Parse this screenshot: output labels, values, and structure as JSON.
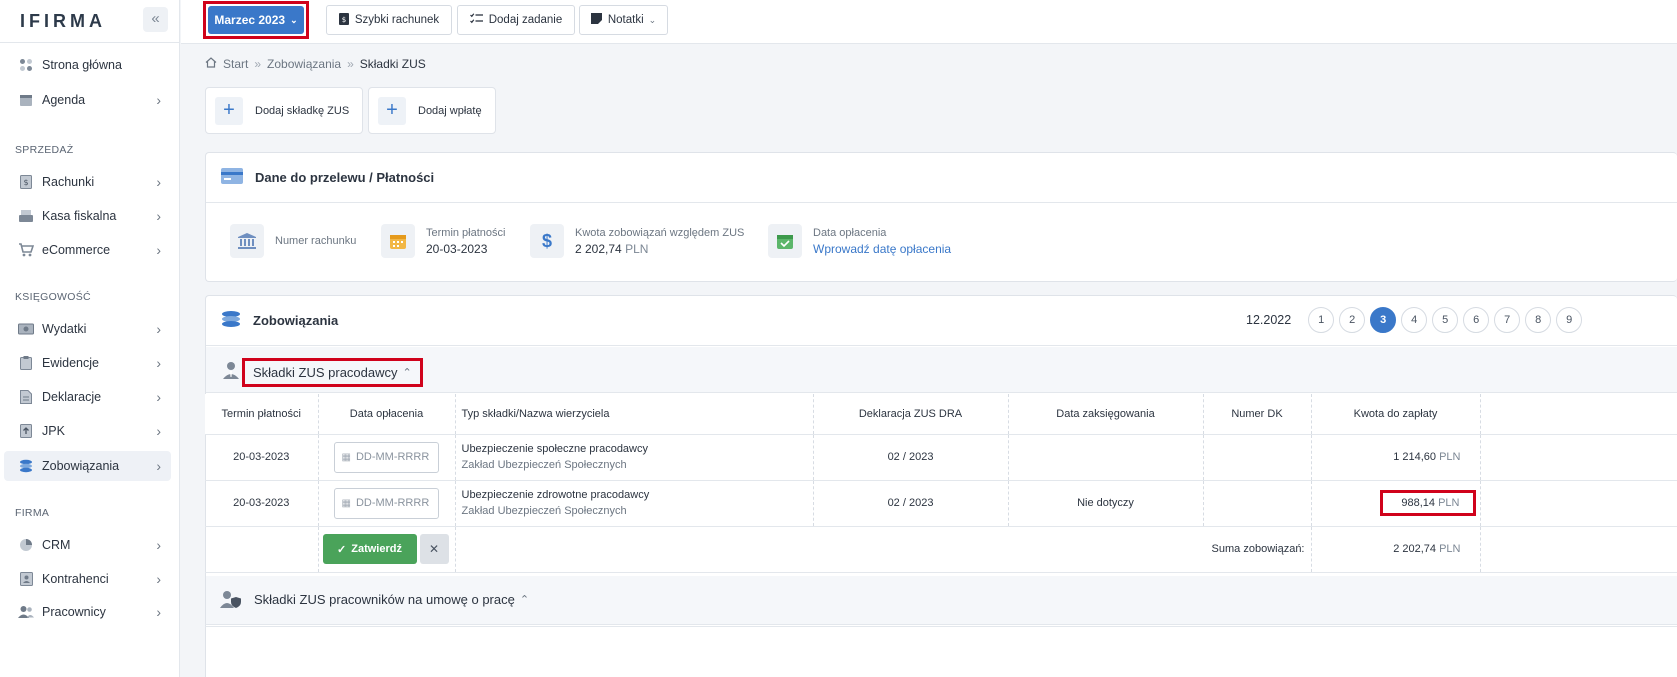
{
  "app": {
    "logo": "IFIRMA"
  },
  "sidebar": {
    "items": [
      {
        "label": "Strona główna"
      },
      {
        "label": "Agenda"
      },
      {
        "label": "Rachunki"
      },
      {
        "label": "Kasa fiskalna"
      },
      {
        "label": "eCommerce"
      },
      {
        "label": "Wydatki"
      },
      {
        "label": "Ewidencje"
      },
      {
        "label": "Deklaracje"
      },
      {
        "label": "JPK"
      },
      {
        "label": "Zobowiązania"
      },
      {
        "label": "CRM"
      },
      {
        "label": "Kontrahenci"
      },
      {
        "label": "Pracownicy"
      }
    ],
    "sections": {
      "sales": "SPRZEDAŻ",
      "accounting": "KSIĘGOWOŚĆ",
      "company": "FIRMA"
    }
  },
  "topbar": {
    "month": "Marzec 2023",
    "quick_invoice": "Szybki rachunek",
    "add_task": "Dodaj zadanie",
    "notes": "Notatki"
  },
  "breadcrumb": {
    "start": "Start",
    "liabilities": "Zobowiązania",
    "current": "Składki ZUS"
  },
  "actions": {
    "add_contribution": "Dodaj składkę ZUS",
    "add_payment": "Dodaj wpłatę"
  },
  "transfer": {
    "title": "Dane do przelewu / Płatności",
    "account_label": "Numer rachunku",
    "due_label": "Termin płatności",
    "due_value": "20-03-2023",
    "amount_label": "Kwota zobowiązań względem ZUS",
    "amount_value": "2 202,74",
    "currency": "PLN",
    "paid_label": "Data opłacenia",
    "paid_link": "Wprowadź datę opłacenia"
  },
  "liabilities": {
    "title": "Zobowiązania",
    "period": "12.2022",
    "pages": [
      "1",
      "2",
      "3",
      "4",
      "5",
      "6",
      "7",
      "8",
      "9"
    ],
    "active_page": "3"
  },
  "employer": {
    "title": "Składki ZUS pracodawcy",
    "columns": [
      "Termin płatności",
      "Data opłacenia",
      "Typ składki/Nazwa wierzyciela",
      "Deklaracja ZUS DRA",
      "Data zaksięgowania",
      "Numer DK",
      "Kwota do zapłaty"
    ],
    "date_placeholder": "DD-MM-RRRR",
    "rows": [
      {
        "due": "20-03-2023",
        "type": "Ubezpieczenie społeczne pracodawcy",
        "creditor": "Zakład Ubezpieczeń Społecznych",
        "declaration": "02 / 2023",
        "booked": "",
        "dk": "",
        "amount": "1 214,60",
        "currency": "PLN"
      },
      {
        "due": "20-03-2023",
        "type": "Ubezpieczenie zdrowotne pracodawcy",
        "creditor": "Zakład Ubezpieczeń Społecznych",
        "declaration": "02 / 2023",
        "booked": "Nie dotyczy",
        "dk": "",
        "amount": "988,14",
        "currency": "PLN"
      }
    ],
    "confirm": "Zatwierdź",
    "sum_label": "Suma zobowiązań:",
    "sum_value": "2 202,74",
    "sum_currency": "PLN"
  },
  "employees": {
    "title": "Składki ZUS pracowników na umowę o pracę"
  },
  "colors": {
    "accent": "#3a78c9",
    "highlight": "#d0021b",
    "success": "#4aa35a"
  }
}
